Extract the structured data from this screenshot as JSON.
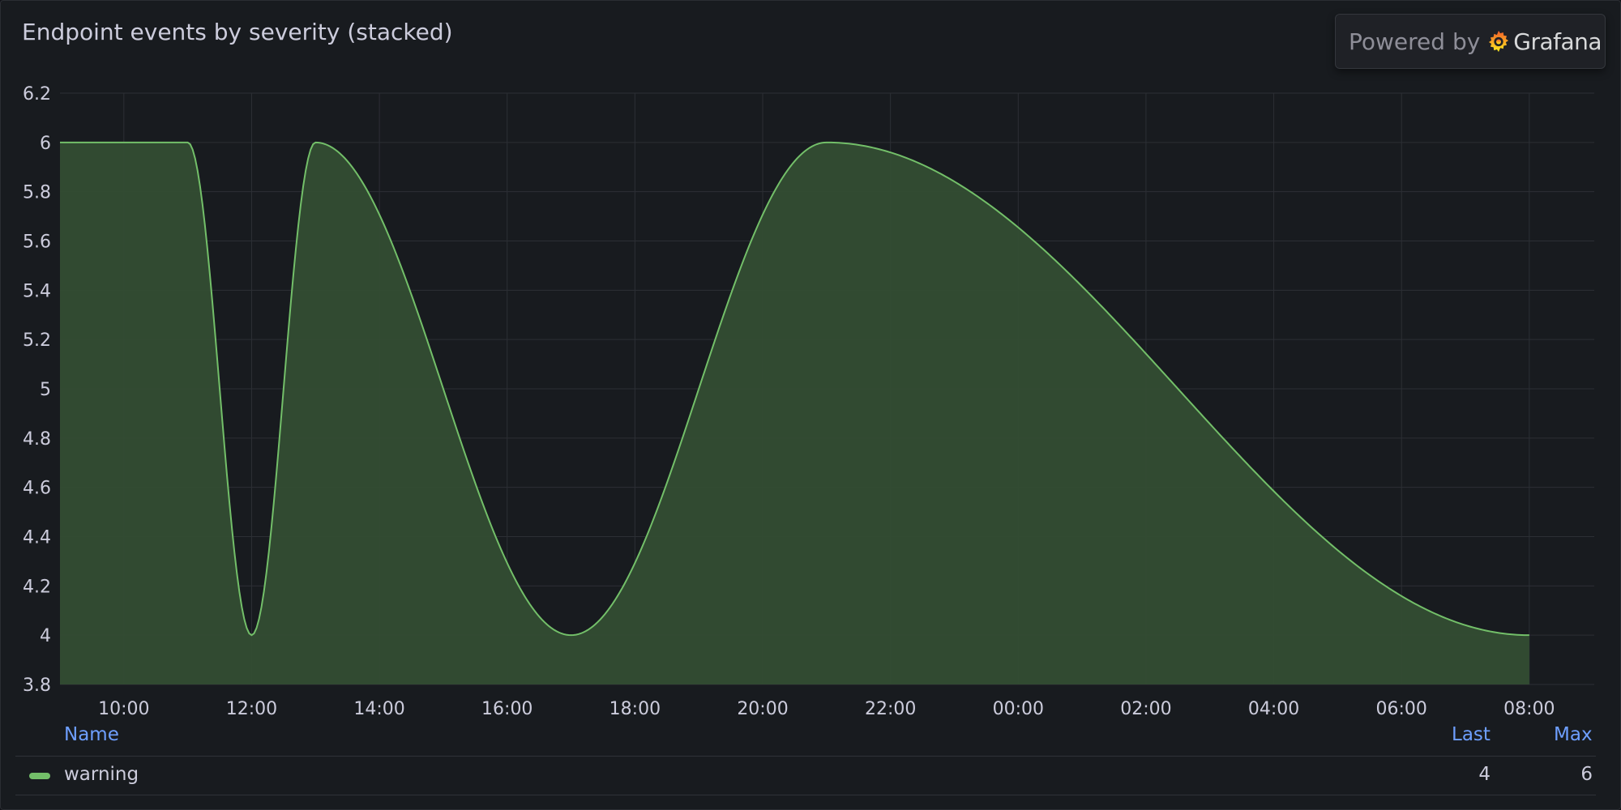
{
  "panel": {
    "title": "Endpoint events by severity (stacked)"
  },
  "branding": {
    "powered_by": "Powered by",
    "brand_name": "Grafana",
    "icon": "grafana-logo-icon"
  },
  "legend": {
    "headers": {
      "name": "Name",
      "last": "Last",
      "max": "Max"
    },
    "items": [
      {
        "name": "warning",
        "color": "#73bf69",
        "last": "4",
        "max": "6"
      }
    ]
  },
  "colors": {
    "background": "#181b1f",
    "grid": "#2c2f35",
    "series_line": "#73bf69",
    "series_fill": "#334d33",
    "legend_header": "#6e9fff"
  },
  "chart_data": {
    "type": "area",
    "title": "Endpoint events by severity (stacked)",
    "stacked": true,
    "xlabel": "",
    "ylabel": "",
    "x_ticks": [
      "10:00",
      "12:00",
      "14:00",
      "16:00",
      "18:00",
      "20:00",
      "22:00",
      "00:00",
      "02:00",
      "04:00",
      "06:00",
      "08:00"
    ],
    "y_ticks": [
      "3.8",
      "4",
      "4.2",
      "4.4",
      "4.6",
      "4.8",
      "5",
      "5.2",
      "5.4",
      "5.6",
      "5.8",
      "6",
      "6.2"
    ],
    "ylim": [
      3.8,
      6.2
    ],
    "grid": true,
    "legend_placement": "bottom",
    "series": [
      {
        "name": "warning",
        "color": "#73bf69",
        "x": [
          "09:00",
          "10:00",
          "11:00",
          "12:00",
          "13:00",
          "17:00",
          "21:00",
          "08:00"
        ],
        "values": [
          6,
          6,
          6,
          4,
          6,
          4,
          6,
          4
        ]
      }
    ]
  }
}
